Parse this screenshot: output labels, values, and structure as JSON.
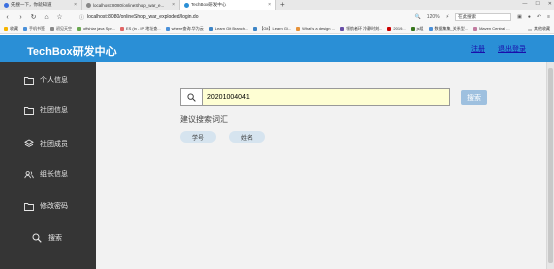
{
  "browser": {
    "tabs": [
      {
        "title": "先搜一下，你就知道",
        "color": "#3b6fe0"
      },
      {
        "title": "localhost:8080/onlineShop_war_e...",
        "color": "#888888"
      },
      {
        "title": "TechBox研发中心",
        "color": "#2a8fd6"
      }
    ],
    "new_tab": "+",
    "url": "localhost:8080/onlineShop_war_exploded/login.do",
    "zoom": "120%",
    "search_placeholder": "在此搜索",
    "bookmarks": [
      {
        "label": "收藏",
        "color": "#f5b400"
      },
      {
        "label": "手机书签",
        "color": "#4a90d9"
      },
      {
        "label": "初见天空",
        "color": "#888888"
      },
      {
        "label": "offshiar java Spr...",
        "color": "#6aa84f"
      },
      {
        "label": "ES (in - IP 地址查...",
        "color": "#e06666"
      },
      {
        "label": "where查询-华为云",
        "color": "#4a90d9"
      },
      {
        "label": "Learn Git Branch...",
        "color": "#3d85c6"
      },
      {
        "label": "【Git】Learn Gi...",
        "color": "#3d85c6"
      },
      {
        "label": "What's a design ...",
        "color": "#e69138"
      },
      {
        "label": "领航者环 冷静时刻...",
        "color": "#674ea7"
      },
      {
        "label": "2019...",
        "color": "#cc0000"
      },
      {
        "label": "js组",
        "color": "#38761d"
      },
      {
        "label": "数据集集_关系型...",
        "color": "#4a90d9"
      },
      {
        "label": "Maven Central ...",
        "color": "#c27ba0"
      }
    ],
    "other_bookmarks": "其他收藏"
  },
  "header": {
    "brand": "TechBox研发中心",
    "link_register": "注册",
    "link_logout": "退出登录"
  },
  "sidebar": {
    "items": [
      {
        "label": "个人信息",
        "icon": "folder-icon"
      },
      {
        "label": "社团信息",
        "icon": "folder-icon"
      },
      {
        "label": "社团成员",
        "icon": "layers-icon"
      },
      {
        "label": "组长信息",
        "icon": "users-icon"
      },
      {
        "label": "修改密码",
        "icon": "folder-icon"
      },
      {
        "label": "搜索",
        "icon": "search-icon"
      }
    ]
  },
  "main": {
    "search_value": "20201004041",
    "search_button": "搜索",
    "suggest_title": "建议搜索词汇",
    "chips": [
      "学号",
      "姓名"
    ]
  }
}
